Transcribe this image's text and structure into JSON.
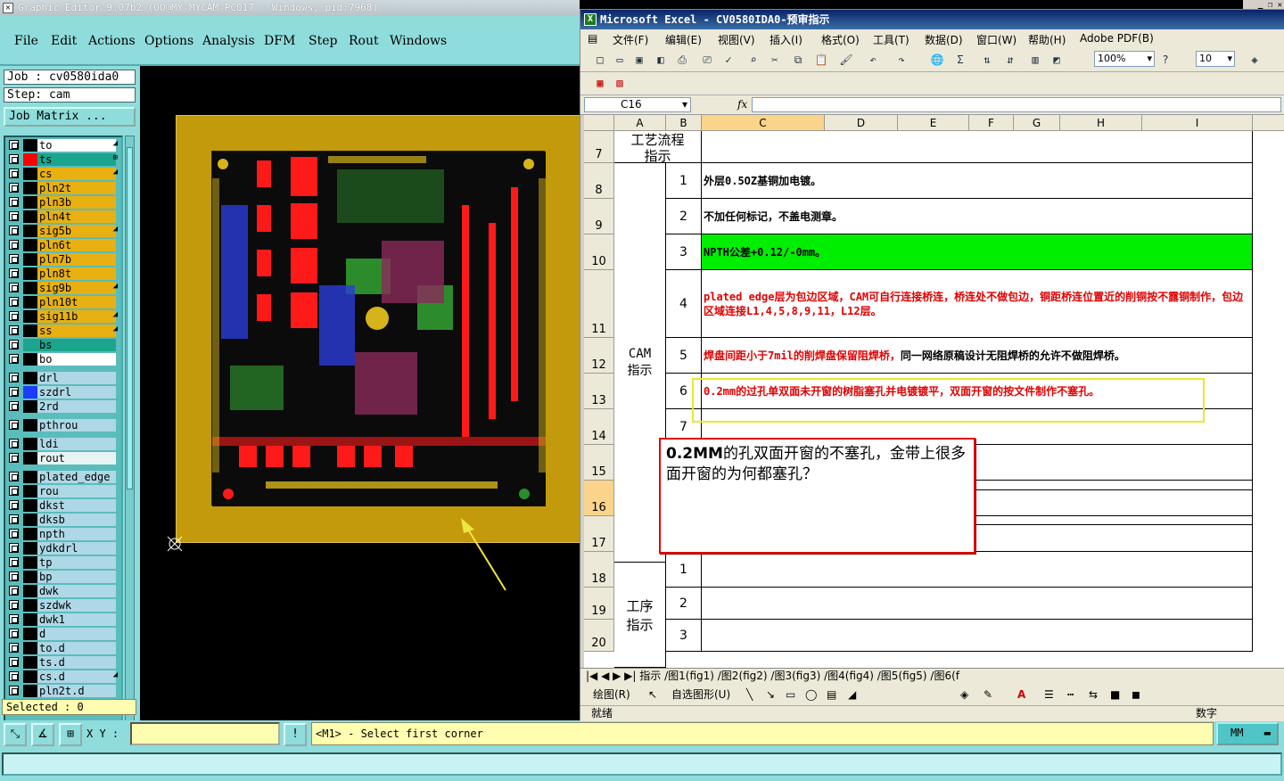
{
  "genesis": {
    "title": "Graphic Editor 9.07b2 (OO@MY-MYCAM-PC017 - Windows, pid:7968)",
    "menu": [
      "File",
      "Edit",
      "Actions",
      "Options",
      "Analysis",
      "DFM",
      "Step",
      "Rout",
      "Windows"
    ],
    "job_label": "Job : cv0580ida0",
    "step_label": "Step: cam",
    "job_matrix": "Job Matrix ...",
    "layers": [
      {
        "name": "to",
        "color": "#ffffff",
        "swatch": "#000000",
        "arrow": "◢"
      },
      {
        "name": "ts",
        "color": "#1aa58c",
        "swatch": "#ff0000",
        "arrow": "⊞"
      },
      {
        "name": "cs",
        "color": "#e8b010",
        "swatch": "#000000",
        "arrow": "◢"
      },
      {
        "name": "pln2t",
        "color": "#e8b010",
        "swatch": "#000000",
        "arrow": ""
      },
      {
        "name": "pln3b",
        "color": "#e8b010",
        "swatch": "#000000",
        "arrow": ""
      },
      {
        "name": "pln4t",
        "color": "#e8b010",
        "swatch": "#000000",
        "arrow": ""
      },
      {
        "name": "sig5b",
        "color": "#e8b010",
        "swatch": "#000000",
        "arrow": "◢"
      },
      {
        "name": "pln6t",
        "color": "#e8b010",
        "swatch": "#000000",
        "arrow": ""
      },
      {
        "name": "pln7b",
        "color": "#e8b010",
        "swatch": "#000000",
        "arrow": ""
      },
      {
        "name": "pln8t",
        "color": "#e8b010",
        "swatch": "#000000",
        "arrow": ""
      },
      {
        "name": "sig9b",
        "color": "#e8b010",
        "swatch": "#000000",
        "arrow": "◢"
      },
      {
        "name": "pln10t",
        "color": "#e8b010",
        "swatch": "#000000",
        "arrow": ""
      },
      {
        "name": "sig11b",
        "color": "#e8b010",
        "swatch": "#000000",
        "arrow": "◢"
      },
      {
        "name": "ss",
        "color": "#e8b010",
        "swatch": "#000000",
        "arrow": "◢"
      },
      {
        "name": "bs",
        "color": "#1aa58c",
        "swatch": "#1aa58c",
        "arrow": ""
      },
      {
        "name": "bo",
        "color": "#ffffff",
        "swatch": "#000000",
        "arrow": ""
      },
      {
        "name": "drl",
        "color": "#aed8e6",
        "swatch": "#000000",
        "arrow": ""
      },
      {
        "name": "szdrl",
        "color": "#aed8e6",
        "swatch": "#1a3cff",
        "arrow": ""
      },
      {
        "name": "2rd",
        "color": "#aed8e6",
        "swatch": "#000000",
        "arrow": ""
      },
      {
        "name": "pthrou",
        "color": "#aed8e6",
        "swatch": "#000000",
        "arrow": ""
      },
      {
        "name": "ldi",
        "color": "#aed8e6",
        "swatch": "#000000",
        "arrow": ""
      },
      {
        "name": "rout",
        "color": "#e8f4f4",
        "swatch": "#000000",
        "arrow": ""
      },
      {
        "name": "plated_edge",
        "color": "#aed8e6",
        "swatch": "#000000",
        "arrow": ""
      },
      {
        "name": "rou",
        "color": "#aed8e6",
        "swatch": "#000000",
        "arrow": ""
      },
      {
        "name": "dkst",
        "color": "#aed8e6",
        "swatch": "#000000",
        "arrow": ""
      },
      {
        "name": "dksb",
        "color": "#aed8e6",
        "swatch": "#000000",
        "arrow": ""
      },
      {
        "name": "npth",
        "color": "#aed8e6",
        "swatch": "#000000",
        "arrow": ""
      },
      {
        "name": "ydkdrl",
        "color": "#aed8e6",
        "swatch": "#000000",
        "arrow": ""
      },
      {
        "name": "tp",
        "color": "#aed8e6",
        "swatch": "#000000",
        "arrow": ""
      },
      {
        "name": "bp",
        "color": "#aed8e6",
        "swatch": "#000000",
        "arrow": ""
      },
      {
        "name": "dwk",
        "color": "#aed8e6",
        "swatch": "#000000",
        "arrow": ""
      },
      {
        "name": "szdwk",
        "color": "#aed8e6",
        "swatch": "#000000",
        "arrow": ""
      },
      {
        "name": "dwk1",
        "color": "#aed8e6",
        "swatch": "#000000",
        "arrow": ""
      },
      {
        "name": "d",
        "color": "#aed8e6",
        "swatch": "#000000",
        "arrow": ""
      },
      {
        "name": "to.d",
        "color": "#aed8e6",
        "swatch": "#000000",
        "arrow": ""
      },
      {
        "name": "ts.d",
        "color": "#aed8e6",
        "swatch": "#000000",
        "arrow": ""
      },
      {
        "name": "cs.d",
        "color": "#aed8e6",
        "swatch": "#000000",
        "arrow": "◢"
      },
      {
        "name": "pln2t.d",
        "color": "#aed8e6",
        "swatch": "#000000",
        "arrow": ""
      }
    ],
    "selected": "Selected : 0",
    "xy_label": "X Y :",
    "xy_value": "",
    "command_message": "<M1> - Select first corner",
    "units": "MM"
  },
  "excel": {
    "title": "Microsoft Excel - CV0580IDA0-预审指示",
    "menu": [
      "文件(F)",
      "编辑(E)",
      "视图(V)",
      "插入(I)",
      "格式(O)",
      "工具(T)",
      "数据(D)",
      "窗口(W)",
      "帮助(H)",
      "Adobe PDF(B)"
    ],
    "zoom": "100%",
    "font_size": "10",
    "name_box": "C16",
    "columns": [
      "A",
      "B",
      "C",
      "D",
      "E",
      "F",
      "G",
      "H",
      "I"
    ],
    "header_label": "工艺流程\n指示",
    "cam_label": "CAM\n指示",
    "proc_label": "工序\n指示",
    "rows": [
      {
        "row": "7"
      },
      {
        "row": "8",
        "num": "1",
        "text": "外层0.5OZ基铜加电镀。",
        "color": "#000000",
        "bg": ""
      },
      {
        "row": "9",
        "num": "2",
        "text": "不加任何标记，不盖电测章。",
        "color": "#000000",
        "bg": ""
      },
      {
        "row": "10",
        "num": "3",
        "text": "NPTH公差+0.12/-0mm。",
        "color": "#000000",
        "bg": "#00ee00"
      },
      {
        "row": "11",
        "num": "4",
        "text": "plated edge层为包边区域，CAM可自行连接桥连，桥连处不做包边，铜距桥连位置近的削铜按不露铜制作，包边区域连接L1,4,5,8,9,11，L12层。",
        "color": "#e00000",
        "bg": ""
      },
      {
        "row": "12",
        "num": "5",
        "text": "焊盘间距小于7mil的削焊盘保留阻焊桥，",
        "text2": "同一网络原稿设计无阻焊桥的允许不做阻焊桥。",
        "color": "#e00000",
        "bg": ""
      },
      {
        "row": "13",
        "num": "6",
        "text": "0.2mm的过孔单双面未开窗的树脂塞孔并电镀镀平，双面开窗的按文件制作不塞孔。",
        "color": "#e00000",
        "bg": ""
      },
      {
        "row": "14",
        "num": "7",
        "text": "",
        "color": "#000000",
        "bg": ""
      },
      {
        "row": "15",
        "num": "",
        "text": "",
        "color": "#000000",
        "bg": ""
      },
      {
        "row": "16",
        "num": "",
        "text": "",
        "color": "#000000",
        "bg": ""
      },
      {
        "row": "17",
        "num": "",
        "text": "",
        "color": "#000000",
        "bg": ""
      },
      {
        "row": "18",
        "num": "1",
        "text": "",
        "color": "#000000",
        "bg": ""
      },
      {
        "row": "19",
        "num": "2",
        "text": "",
        "color": "#000000",
        "bg": ""
      },
      {
        "row": "20",
        "num": "3",
        "text": "",
        "color": "#000000",
        "bg": ""
      }
    ],
    "callout_bold": "0.2MM",
    "callout_text": "的孔双面开窗的不塞孔，金带上很多面开窗的为何都塞孔？",
    "sheet_tabs": "指示 /图1(fig1) /图2(fig2) /图3(fig3) /图4(fig4) /图5(fig5) /图6(f",
    "draw_label": "绘图(R)",
    "autoshape_label": "自选图形(U)",
    "status_ready": "就绪",
    "status_num": "数字"
  }
}
